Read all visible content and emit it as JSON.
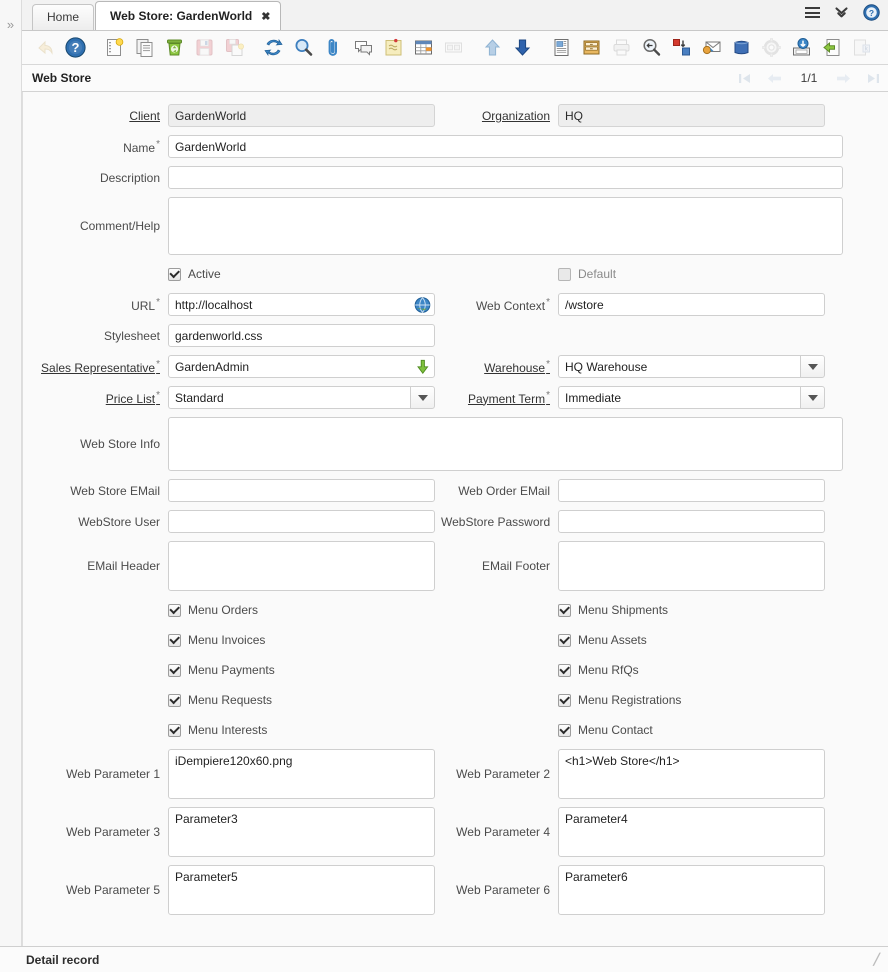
{
  "window": {
    "sidebar_expand_icon": "double-chevron-right-icon",
    "record_title": "Web Store",
    "status_text": "Detail record"
  },
  "tabs": [
    {
      "label": "Home",
      "active": false,
      "closable": false
    },
    {
      "label": "Web Store: GardenWorld",
      "active": true,
      "closable": true,
      "close_glyph": "✖"
    }
  ],
  "tabbar_right": [
    {
      "name": "menu-icon",
      "label": "hamburger-icon"
    },
    {
      "name": "show-more-tabs-icon",
      "label": "double-chevron-down-icon"
    },
    {
      "name": "help-icon",
      "label": "help-circle-icon"
    }
  ],
  "toolbar": [
    {
      "name": "undo-button",
      "icon": "undo-arrow-icon",
      "enabled": false
    },
    {
      "name": "help-button",
      "icon": "help-circle-icon",
      "enabled": true
    },
    {
      "name": "new-record-button",
      "icon": "new-document-icon",
      "enabled": true
    },
    {
      "name": "copy-record-button",
      "icon": "copy-documents-icon",
      "enabled": true
    },
    {
      "name": "delete-record-button",
      "icon": "green-recycle-bin-icon",
      "enabled": true
    },
    {
      "name": "save-button",
      "icon": "floppy-disk-icon",
      "enabled": false
    },
    {
      "name": "save-create-new-button",
      "icon": "save-new-icon",
      "enabled": false
    },
    {
      "name": "refresh-button",
      "icon": "refresh-arrows-icon",
      "enabled": true
    },
    {
      "name": "find-button",
      "icon": "magnifier-icon",
      "enabled": true
    },
    {
      "name": "attachment-button",
      "icon": "paperclip-icon",
      "enabled": true
    },
    {
      "name": "chat-button",
      "icon": "speech-bubbles-icon",
      "enabled": true
    },
    {
      "name": "post-it-button",
      "icon": "sticky-note-icon",
      "enabled": true
    },
    {
      "name": "grid-toggle-button",
      "icon": "table-grid-icon",
      "enabled": true
    },
    {
      "name": "multi-selection-button",
      "icon": "two-panels-icon",
      "enabled": false
    },
    {
      "name": "parent-record-button",
      "icon": "up-arrow-icon",
      "enabled": true
    },
    {
      "name": "detail-record-button",
      "icon": "down-arrow-icon",
      "enabled": true
    },
    {
      "name": "report-button",
      "icon": "report-page-icon",
      "enabled": true
    },
    {
      "name": "archive-button",
      "icon": "archive-drawer-icon",
      "enabled": true
    },
    {
      "name": "print-button",
      "icon": "printer-icon",
      "enabled": false
    },
    {
      "name": "print-preview-button",
      "icon": "print-preview-icon",
      "enabled": true
    },
    {
      "name": "zoom-across-button",
      "icon": "zoom-across-icon",
      "enabled": true
    },
    {
      "name": "request-button",
      "icon": "mail-request-icon",
      "enabled": true
    },
    {
      "name": "product-info-button",
      "icon": "blue-box-icon",
      "enabled": true
    },
    {
      "name": "preference-button",
      "icon": "gear-icon",
      "enabled": false
    },
    {
      "name": "archived-records-button",
      "icon": "archive-load-icon",
      "enabled": true
    },
    {
      "name": "export-button",
      "icon": "export-green-arrow-icon",
      "enabled": true
    },
    {
      "name": "exit-button",
      "icon": "exit-icon",
      "enabled": false
    }
  ],
  "record_nav": {
    "first": "first-record-icon",
    "prev": "previous-record-icon",
    "position": "1/1",
    "next": "next-record-icon",
    "last": "last-record-icon"
  },
  "form": {
    "client": {
      "label": "Client",
      "value": "GardenWorld",
      "link": true,
      "readonly": true
    },
    "organization": {
      "label": "Organization",
      "value": "HQ",
      "link": true,
      "readonly": true
    },
    "name": {
      "label": "Name",
      "value": "GardenWorld",
      "required": true
    },
    "description": {
      "label": "Description",
      "value": ""
    },
    "comment_help": {
      "label": "Comment/Help",
      "value": ""
    },
    "active": {
      "label": "Active",
      "checked": true
    },
    "default": {
      "label": "Default",
      "checked": false
    },
    "url": {
      "label": "URL",
      "value": "http://localhost",
      "required": true,
      "icon": "globe-icon"
    },
    "web_context": {
      "label": "Web Context",
      "value": "/wstore",
      "required": true
    },
    "stylesheet": {
      "label": "Stylesheet",
      "value": "gardenworld.css"
    },
    "sales_representative": {
      "label": "Sales Representative",
      "value": "GardenAdmin",
      "required": true,
      "link": true,
      "icon": "green-down-arrow-icon"
    },
    "warehouse": {
      "label": "Warehouse",
      "value": "HQ Warehouse",
      "required": true,
      "link": true,
      "dropdown": true
    },
    "price_list": {
      "label": "Price List",
      "value": "Standard",
      "required": true,
      "link": true,
      "dropdown": true
    },
    "payment_term": {
      "label": "Payment Term",
      "value": "Immediate",
      "required": true,
      "link": true,
      "dropdown": true
    },
    "web_store_info": {
      "label": "Web Store Info",
      "value": ""
    },
    "web_store_email": {
      "label": "Web Store EMail",
      "value": ""
    },
    "web_order_email": {
      "label": "Web Order EMail",
      "value": ""
    },
    "webstore_user": {
      "label": "WebStore User",
      "value": ""
    },
    "webstore_password": {
      "label": "WebStore Password",
      "value": ""
    },
    "email_header": {
      "label": "EMail Header",
      "value": ""
    },
    "email_footer": {
      "label": "EMail Footer",
      "value": ""
    },
    "menu_checkboxes_left": [
      {
        "label": "Menu Orders",
        "checked": true
      },
      {
        "label": "Menu Invoices",
        "checked": true
      },
      {
        "label": "Menu Payments",
        "checked": true
      },
      {
        "label": "Menu Requests",
        "checked": true
      },
      {
        "label": "Menu Interests",
        "checked": true
      }
    ],
    "menu_checkboxes_right": [
      {
        "label": "Menu Shipments",
        "checked": true
      },
      {
        "label": "Menu Assets",
        "checked": true
      },
      {
        "label": "Menu RfQs",
        "checked": true
      },
      {
        "label": "Menu Registrations",
        "checked": true
      },
      {
        "label": "Menu Contact",
        "checked": true
      }
    ],
    "web_parameter_1": {
      "label": "Web Parameter 1",
      "value": "iDempiere120x60.png"
    },
    "web_parameter_2": {
      "label": "Web Parameter 2",
      "value": "<h1>Web Store</h1>"
    },
    "web_parameter_3": {
      "label": "Web Parameter 3",
      "value": "Parameter3"
    },
    "web_parameter_4": {
      "label": "Web Parameter 4",
      "value": "Parameter4"
    },
    "web_parameter_5": {
      "label": "Web Parameter 5",
      "value": "Parameter5"
    },
    "web_parameter_6": {
      "label": "Web Parameter 6",
      "value": "Parameter6"
    }
  },
  "colors": {
    "accent_blue": "#2f6fb0",
    "green": "#6aa437",
    "panel_bg": "#fafafa",
    "border": "#cfcfcf"
  }
}
